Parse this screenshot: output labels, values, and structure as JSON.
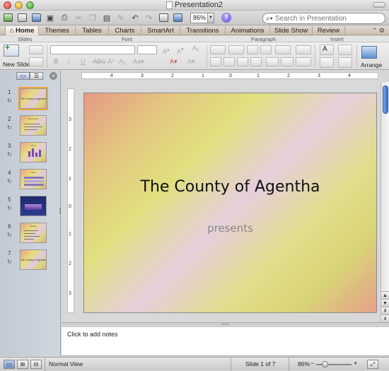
{
  "window": {
    "title": "Presentation2"
  },
  "toolbar": {
    "zoom": "86%",
    "search_placeholder": "Search in Presentation",
    "help": "?"
  },
  "ribbon_tabs": [
    "Home",
    "Themes",
    "Tables",
    "Charts",
    "SmartArt",
    "Transitions",
    "Animations",
    "Slide Show",
    "Review"
  ],
  "ribbon_groups": {
    "slides": "Slides",
    "font": "Font",
    "paragraph": "Paragraph",
    "insert": "Insert"
  },
  "ribbon": {
    "new_slide": "New Slide",
    "arrange": "Arrange"
  },
  "sidebar": {
    "thumbnails": [
      {
        "number": "1",
        "label": "The County of Agentha"
      },
      {
        "number": "2",
        "label": "Introduction"
      },
      {
        "number": "3",
        "label": "Chart"
      },
      {
        "number": "4",
        "label": "Table"
      },
      {
        "number": "5",
        "label": ""
      },
      {
        "number": "6",
        "label": "Bullets"
      },
      {
        "number": "7",
        "label": "The County of Agentha"
      }
    ]
  },
  "slide": {
    "title": "The County of Agentha",
    "subtitle": "presents"
  },
  "ruler": {
    "horizontal": [
      "4",
      "3",
      "2",
      "1",
      "0",
      "1",
      "2",
      "3",
      "4"
    ],
    "vertical": [
      "3",
      "2",
      "1",
      "0",
      "1",
      "2",
      "3"
    ]
  },
  "notes": {
    "placeholder": "Click to add notes"
  },
  "status": {
    "view": "Normal View",
    "slide_position": "Slide 1 of 7",
    "zoom": "86%"
  },
  "colors": {
    "accent": "#f2a33a",
    "selection_blue": "#2f6fcf"
  }
}
